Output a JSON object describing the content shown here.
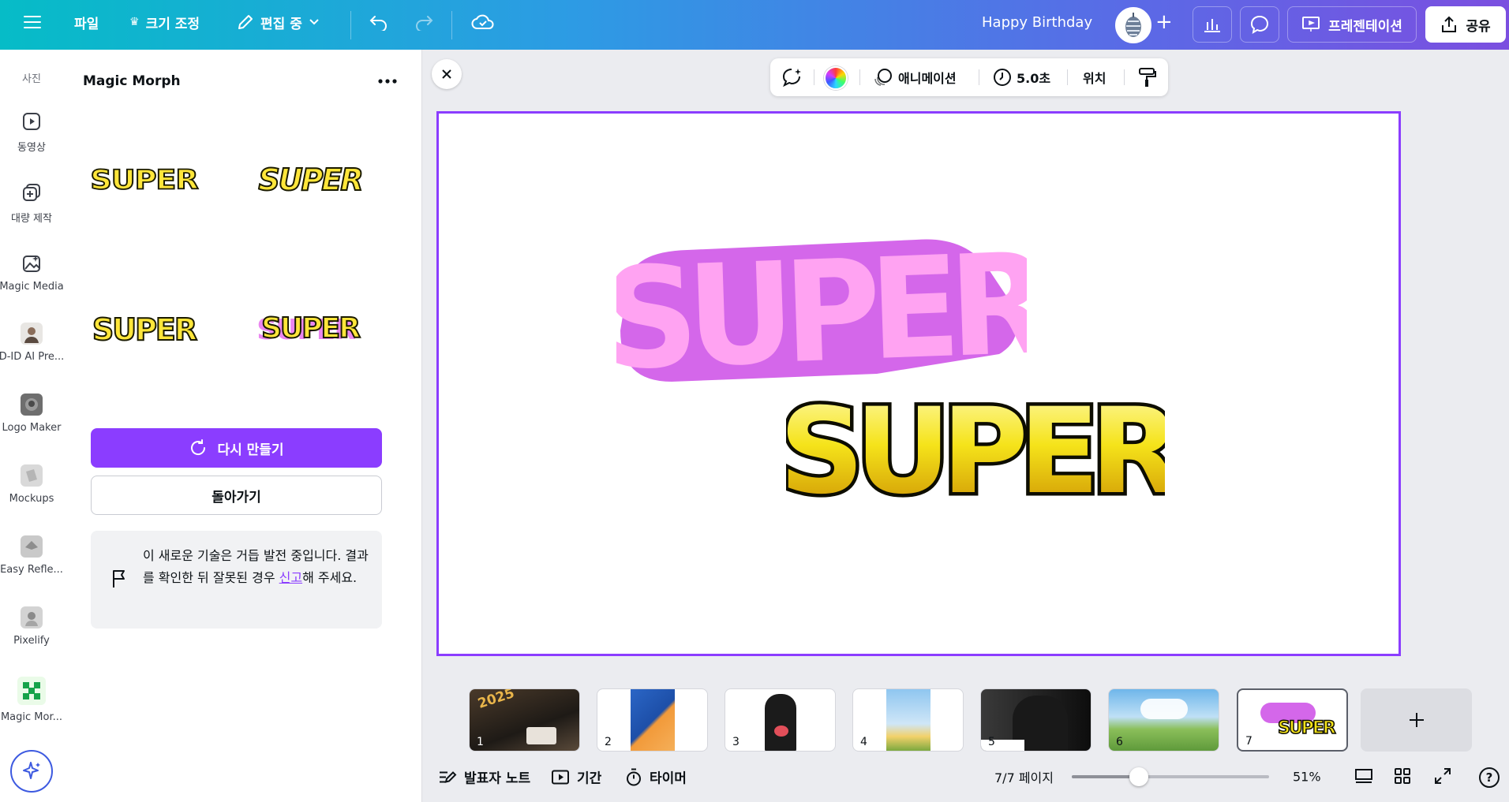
{
  "topbar": {
    "file_label": "파일",
    "resize_label": "크기 조정",
    "edit_mode_label": "편집 중",
    "doc_title": "Happy Birthday",
    "present_label": "프레젠테이션",
    "share_label": "공유"
  },
  "rail": {
    "items": [
      {
        "label": "사진"
      },
      {
        "label": "동영상"
      },
      {
        "label": "대량 제작"
      },
      {
        "label": "Magic Media"
      },
      {
        "label": "D-ID AI Pre..."
      },
      {
        "label": "Logo Maker"
      },
      {
        "label": "Mockups"
      },
      {
        "label": "Easy Refle..."
      },
      {
        "label": "Pixelify"
      },
      {
        "label": "Magic Mor..."
      }
    ]
  },
  "panel": {
    "title": "Magic Morph",
    "results": [
      "SUPER",
      "SUPER",
      "SUPER",
      "SUPER"
    ],
    "regenerate_label": "다시 만들기",
    "back_label": "돌아가기",
    "notice_text": "이 새로운 기술은 거듭 발전 중입니다. 결과를 확인한 뒤 잘못된 경우 ",
    "notice_link": "신고",
    "notice_suffix": "해 주세요."
  },
  "context_toolbar": {
    "animation_label": "애니메이션",
    "duration_label": "5.0초",
    "position_label": "위치"
  },
  "canvas": {
    "back_text": "SUPER",
    "front_text": "SUPER"
  },
  "thumbnails": [
    {
      "num": "1"
    },
    {
      "num": "2"
    },
    {
      "num": "3"
    },
    {
      "num": "4"
    },
    {
      "num": "5"
    },
    {
      "num": "6"
    },
    {
      "num": "7"
    }
  ],
  "thumb1_text": "2025",
  "thumb7_text": "SUPER",
  "bottombar": {
    "notes_label": "발표자 노트",
    "duration_label": "기간",
    "timer_label": "타이머",
    "page_indicator": "7/7 페이지",
    "zoom_label": "51%",
    "zoom_level": 0.51
  },
  "colors": {
    "accent": "#8b3dff",
    "pink_fill": "#ffa3f2",
    "pink_outline": "#d467ea",
    "gold": "#f5e31a"
  }
}
